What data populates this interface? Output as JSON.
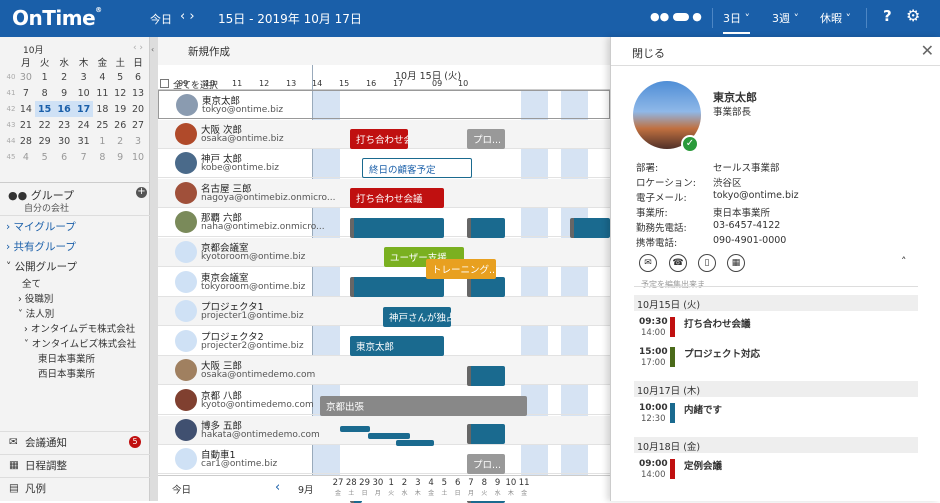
{
  "header": {
    "logo": "OnTime",
    "today": "今日",
    "nav": "‹ ›",
    "date": "15日 - 2019年 10月 17日",
    "view_3day": "3日",
    "view_3week": "3週",
    "leave": "休暇",
    "help": "?"
  },
  "calendar": {
    "month": "10月",
    "nav": "‹ ›",
    "weekdays": [
      "月",
      "火",
      "水",
      "木",
      "金",
      "土",
      "日"
    ],
    "weeks": [
      {
        "wk": "40",
        "days": [
          "30",
          "1",
          "2",
          "3",
          "4",
          "5",
          "6"
        ]
      },
      {
        "wk": "41",
        "days": [
          "7",
          "8",
          "9",
          "10",
          "11",
          "12",
          "13"
        ]
      },
      {
        "wk": "42",
        "days": [
          "14",
          "15",
          "16",
          "17",
          "18",
          "19",
          "20"
        ]
      },
      {
        "wk": "43",
        "days": [
          "21",
          "22",
          "23",
          "24",
          "25",
          "26",
          "27"
        ]
      },
      {
        "wk": "44",
        "days": [
          "28",
          "29",
          "30",
          "31",
          "1",
          "2",
          "3"
        ]
      },
      {
        "wk": "45",
        "days": [
          "4",
          "5",
          "6",
          "7",
          "8",
          "9",
          "10"
        ]
      }
    ]
  },
  "sidebar": {
    "group": "グループ",
    "group_sub": "自分の会社",
    "my_group": "マイグループ",
    "shared_group": "共有グループ",
    "public_group": "公開グループ",
    "all": "全て",
    "role": "役職別",
    "corp": "法人別",
    "org1": "オンタイムデモ株式会社",
    "org2": "オンタイムビズ株式会社",
    "dept1": "東日本事業所",
    "dept2": "西日本事業所",
    "meeting_notice": "会議通知",
    "notice_badge": "5",
    "schedule": "日程調整",
    "legend": "凡例"
  },
  "grid": {
    "new": "新規作成",
    "select_all": "全てを選択",
    "date_label": "10月 15日 (火)",
    "hours": [
      "09",
      "10",
      "11",
      "12",
      "13",
      "14",
      "15",
      "16",
      "17",
      "09",
      "10"
    ],
    "rows": [
      {
        "name": "東京太郎",
        "email": "tokyo@ontime.biz",
        "color": "#8a9bb0"
      },
      {
        "name": "大阪 次郎",
        "email": "osaka@ontime.biz",
        "color": "#b04a2a"
      },
      {
        "name": "神戸 太郎",
        "email": "kobe@ontime.biz",
        "color": "#4a6a8a"
      },
      {
        "name": "名古屋 三郎",
        "email": "nagoya@ontimebiz.onmicro...",
        "color": "#a0503a"
      },
      {
        "name": "那覇 六郎",
        "email": "naha@ontimebiz.onmicro...",
        "color": "#7a8a5a"
      },
      {
        "name": "京都会議室",
        "email": "kyotoroom@ontime.biz",
        "color": "#cfe1f5"
      },
      {
        "name": "東京会議室",
        "email": "tokyoroom@ontime.biz",
        "color": "#cfe1f5"
      },
      {
        "name": "プロジェクタ1",
        "email": "projecter1@ontime.biz",
        "color": "#cfe1f5"
      },
      {
        "name": "プロジェクタ2",
        "email": "projecter2@ontime.biz",
        "color": "#cfe1f5"
      },
      {
        "name": "大阪 三郎",
        "email": "osaka@ontimedemo.com",
        "color": "#a08060"
      },
      {
        "name": "京都 八郎",
        "email": "kyoto@ontimedemo.com",
        "color": "#804030"
      },
      {
        "name": "博多 五郎",
        "email": "hakata@ontimedemo.com",
        "color": "#405070"
      },
      {
        "name": "自動車1",
        "email": "car1@ontime.biz",
        "color": "#cfe1f5"
      }
    ],
    "events": {
      "e1": "打ち合わせ会議",
      "e2": "プロ...",
      "e3": "終日の顧客予定",
      "e4": "打ち合わせ会議",
      "e5": "ユーザー支援",
      "e6": "トレーニング...",
      "e7": "神戸さんが独占",
      "e8": "東京太郎",
      "e9": "京都出張",
      "e10": "プロ..."
    },
    "footer": {
      "today": "今日",
      "month": "9月",
      "days": [
        {
          "d": "27",
          "w": "金"
        },
        {
          "d": "28",
          "w": "土"
        },
        {
          "d": "29",
          "w": "日"
        },
        {
          "d": "30",
          "w": "月"
        },
        {
          "d": "1",
          "w": "火"
        },
        {
          "d": "2",
          "w": "水"
        },
        {
          "d": "3",
          "w": "木"
        },
        {
          "d": "4",
          "w": "金"
        },
        {
          "d": "5",
          "w": "土"
        },
        {
          "d": "6",
          "w": "日"
        },
        {
          "d": "7",
          "w": "月"
        },
        {
          "d": "8",
          "w": "火"
        },
        {
          "d": "9",
          "w": "水"
        },
        {
          "d": "10",
          "w": "木"
        },
        {
          "d": "11",
          "w": "金"
        }
      ]
    }
  },
  "panel": {
    "close": "閉じる",
    "name": "東京太郎",
    "title": "事業部長",
    "fields": [
      {
        "k": "部署:",
        "v": "セールス事業部"
      },
      {
        "k": "ロケーション:",
        "v": "渋谷区"
      },
      {
        "k": "電子メール:",
        "v": "tokyo@ontime.biz"
      },
      {
        "k": "事業所:",
        "v": "東日本事業所"
      },
      {
        "k": "勤務先電話:",
        "v": "03-6457-4122"
      },
      {
        "k": "携帯電話:",
        "v": "090-4901-0000"
      }
    ],
    "hint": "予定を編集出来ま",
    "days": [
      {
        "h": "10月15日 (火)",
        "items": [
          {
            "t1": "09:30",
            "t2": "14:00",
            "title": "打ち合わせ会議",
            "color": "#c01010"
          },
          {
            "t1": "15:00",
            "t2": "17:00",
            "title": "プロジェクト対応",
            "color": "#4a6a1a"
          }
        ]
      },
      {
        "h": "10月17日 (木)",
        "items": [
          {
            "t1": "10:00",
            "t2": "12:30",
            "title": "内緒です",
            "color": "#1a6a8f"
          }
        ]
      },
      {
        "h": "10月18日 (金)",
        "items": [
          {
            "t1": "09:00",
            "t2": "14:00",
            "title": "定例会議",
            "color": "#c01010"
          }
        ]
      }
    ]
  }
}
